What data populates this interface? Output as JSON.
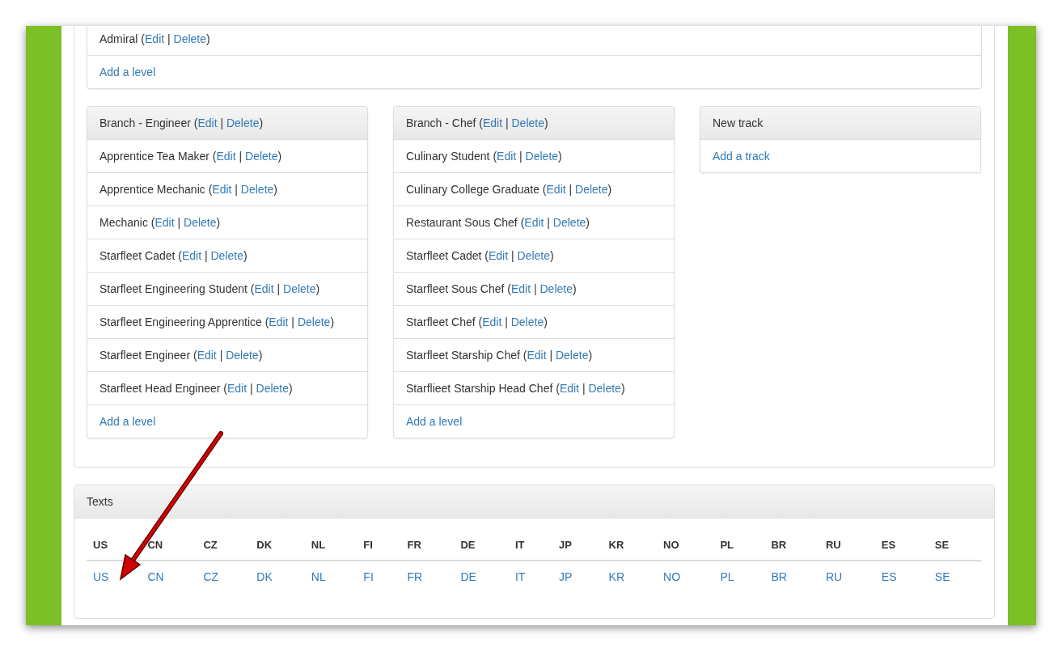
{
  "punctuation": {
    "open": "(",
    "separator": "|",
    "close": ")"
  },
  "top_panel": {
    "items": [
      {
        "name": "Admiral",
        "actions": [
          "Edit",
          "Delete"
        ]
      }
    ],
    "add_link": "Add a level"
  },
  "tracks": [
    {
      "title": "Branch - Engineer",
      "actions": [
        "Edit",
        "Delete"
      ],
      "items": [
        {
          "name": "Apprentice Tea Maker",
          "actions": [
            "Edit",
            "Delete"
          ]
        },
        {
          "name": "Apprentice Mechanic",
          "actions": [
            "Edit",
            "Delete"
          ]
        },
        {
          "name": "Mechanic",
          "actions": [
            "Edit",
            "Delete"
          ]
        },
        {
          "name": "Starfleet Cadet",
          "actions": [
            "Edit",
            "Delete"
          ]
        },
        {
          "name": "Starfleet Engineering Student",
          "actions": [
            "Edit",
            "Delete"
          ]
        },
        {
          "name": "Starfleet Engineering Apprentice",
          "actions": [
            "Edit",
            "Delete"
          ]
        },
        {
          "name": "Starfleet Engineer",
          "actions": [
            "Edit",
            "Delete"
          ]
        },
        {
          "name": "Starfleet Head Engineer",
          "actions": [
            "Edit",
            "Delete"
          ]
        }
      ],
      "add_link": "Add a level"
    },
    {
      "title": "Branch - Chef",
      "actions": [
        "Edit",
        "Delete"
      ],
      "items": [
        {
          "name": "Culinary Student",
          "actions": [
            "Edit",
            "Delete"
          ]
        },
        {
          "name": "Culinary College Graduate",
          "actions": [
            "Edit",
            "Delete"
          ]
        },
        {
          "name": "Restaurant Sous Chef",
          "actions": [
            "Edit",
            "Delete"
          ]
        },
        {
          "name": "Starfleet Cadet",
          "actions": [
            "Edit",
            "Delete"
          ]
        },
        {
          "name": "Starfleet Sous Chef",
          "actions": [
            "Edit",
            "Delete"
          ]
        },
        {
          "name": "Starfleet Chef",
          "actions": [
            "Edit",
            "Delete"
          ]
        },
        {
          "name": "Starfleet Starship Chef",
          "actions": [
            "Edit",
            "Delete"
          ]
        },
        {
          "name": "Starflieet Starship Head Chef",
          "actions": [
            "Edit",
            "Delete"
          ]
        }
      ],
      "add_link": "Add a level"
    },
    {
      "title": "New track",
      "add_link": "Add a track"
    }
  ],
  "texts_panel": {
    "title": "Texts",
    "columns": [
      "US",
      "CN",
      "CZ",
      "DK",
      "NL",
      "FI",
      "FR",
      "DE",
      "IT",
      "JP",
      "KR",
      "NO",
      "PL",
      "BR",
      "RU",
      "ES",
      "SE"
    ],
    "links": [
      "US",
      "CN",
      "CZ",
      "DK",
      "NL",
      "FI",
      "FR",
      "DE",
      "IT",
      "JP",
      "KR",
      "NO",
      "PL",
      "BR",
      "RU",
      "ES",
      "SE"
    ]
  }
}
